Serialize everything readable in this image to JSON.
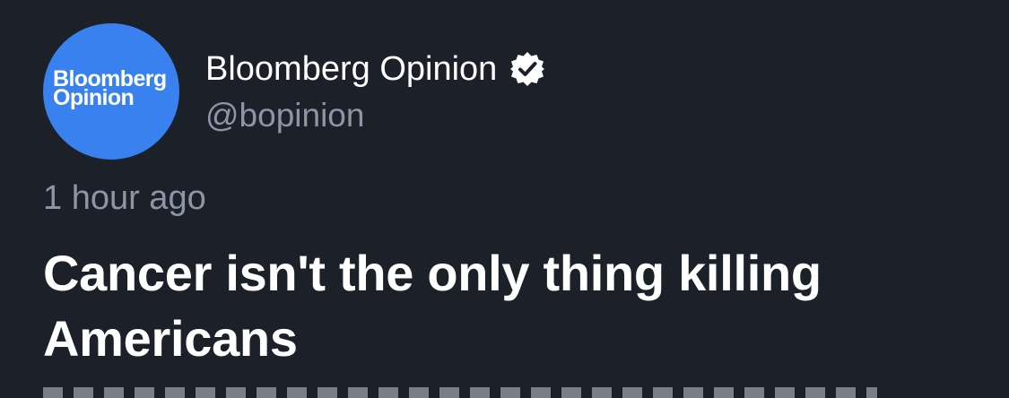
{
  "profile": {
    "avatar_line1": "Bloomberg",
    "avatar_line2": "Opinion",
    "avatar_color": "#3a81f0",
    "display_name": "Bloomberg Opinion",
    "verified": true,
    "verified_icon": "verified-badge-icon",
    "handle": "@bopinion"
  },
  "tweet": {
    "timestamp": "1 hour ago",
    "headline": "Cancer isn't the only thing killing Americans"
  },
  "colors": {
    "background": "#1b2029",
    "primary_text": "#ffffff",
    "secondary_text": "#8b96a6"
  }
}
